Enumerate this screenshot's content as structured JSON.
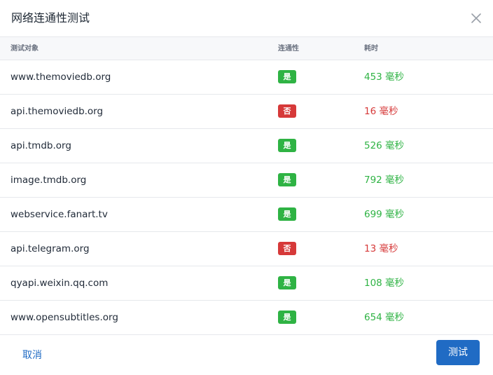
{
  "dialog": {
    "title": "网络连通性测试"
  },
  "table": {
    "headers": {
      "target": "测试对象",
      "connectivity": "连通性",
      "elapsed": "耗时"
    },
    "rows": [
      {
        "host": "www.themoviedb.org",
        "status": "是",
        "time": "453 毫秒",
        "ok": true
      },
      {
        "host": "api.themoviedb.org",
        "status": "否",
        "time": "16 毫秒",
        "ok": false
      },
      {
        "host": "api.tmdb.org",
        "status": "是",
        "time": "526 毫秒",
        "ok": true
      },
      {
        "host": "image.tmdb.org",
        "status": "是",
        "time": "792 毫秒",
        "ok": true
      },
      {
        "host": "webservice.fanart.tv",
        "status": "是",
        "time": "699 毫秒",
        "ok": true
      },
      {
        "host": "api.telegram.org",
        "status": "否",
        "time": "13 毫秒",
        "ok": false
      },
      {
        "host": "qyapi.weixin.qq.com",
        "status": "是",
        "time": "108 毫秒",
        "ok": true
      },
      {
        "host": "www.opensubtitles.org",
        "status": "是",
        "time": "654 毫秒",
        "ok": true
      }
    ]
  },
  "footer": {
    "cancel_label": "取消",
    "test_label": "测试"
  },
  "colors": {
    "success": "#2fb344",
    "danger": "#d63939",
    "primary": "#206bc4"
  },
  "icons": {
    "close": "close-icon"
  }
}
